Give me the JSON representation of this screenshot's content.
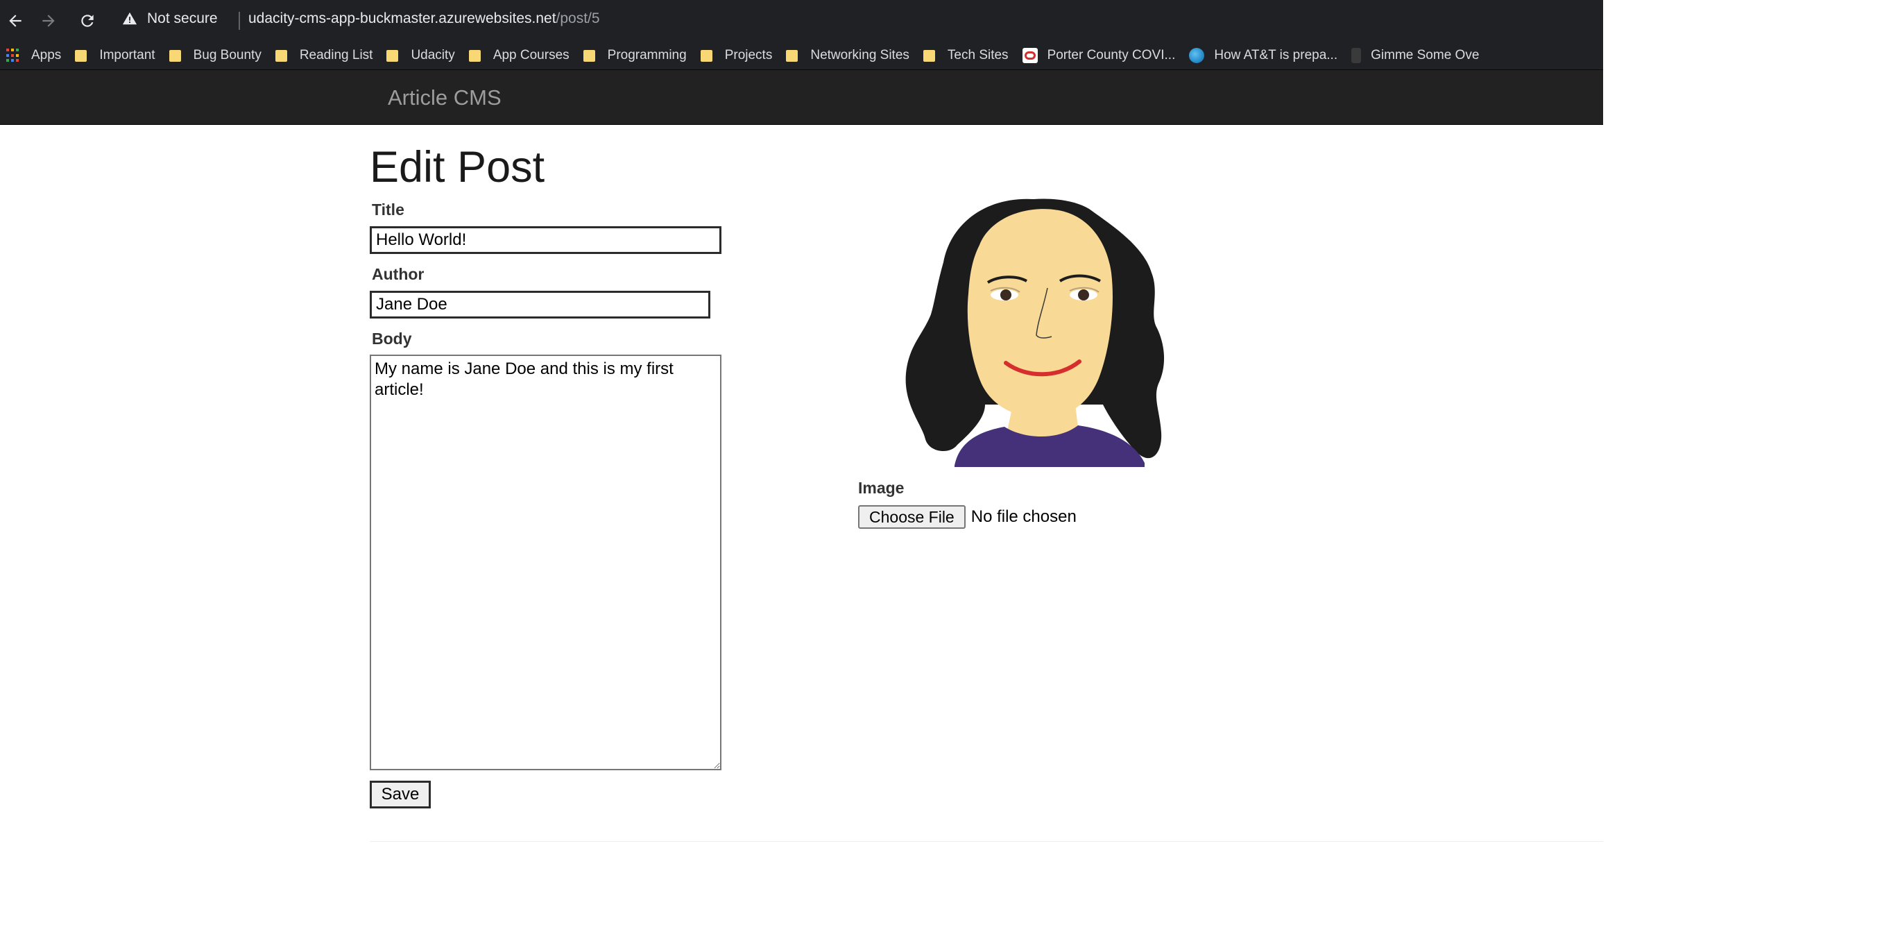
{
  "browser": {
    "security_text": "Not secure",
    "url_host": "udacity-cms-app-buckmaster.azurewebsites.net",
    "url_path": "/post/5",
    "bookmarks": [
      {
        "label": "Apps",
        "icon": "apps-grid-icon"
      },
      {
        "label": "Important",
        "icon": "folder-icon"
      },
      {
        "label": "Bug Bounty",
        "icon": "folder-icon"
      },
      {
        "label": "Reading List",
        "icon": "folder-icon"
      },
      {
        "label": "Udacity",
        "icon": "folder-icon"
      },
      {
        "label": "App Courses",
        "icon": "folder-icon"
      },
      {
        "label": "Programming",
        "icon": "folder-icon"
      },
      {
        "label": "Projects",
        "icon": "folder-icon"
      },
      {
        "label": "Networking Sites",
        "icon": "folder-icon"
      },
      {
        "label": "Tech Sites",
        "icon": "folder-icon"
      },
      {
        "label": "Porter County COVI...",
        "icon": "covid-favicon-icon"
      },
      {
        "label": "How AT&T is prepa...",
        "icon": "att-favicon-icon"
      },
      {
        "label": "Gimme Some Ove",
        "icon": "gimme-favicon-icon"
      }
    ]
  },
  "site": {
    "brand": "Article CMS"
  },
  "page": {
    "title": "Edit Post"
  },
  "form": {
    "title_label": "Title",
    "title_value": "Hello World!",
    "author_label": "Author",
    "author_value": "Jane Doe",
    "body_label": "Body",
    "body_value": "My name is Jane Doe and this is my first article!",
    "image_label": "Image",
    "choose_file_label": "Choose File",
    "file_status": "No file chosen",
    "save_label": "Save"
  },
  "colors": {
    "chrome_bg": "#202124",
    "navbar_bg": "#222222",
    "brand_text": "#9d9d9d",
    "hair": "#1c1c1c",
    "skin": "#f8d995",
    "shirt": "#44317a",
    "lips": "#d62d2d"
  }
}
